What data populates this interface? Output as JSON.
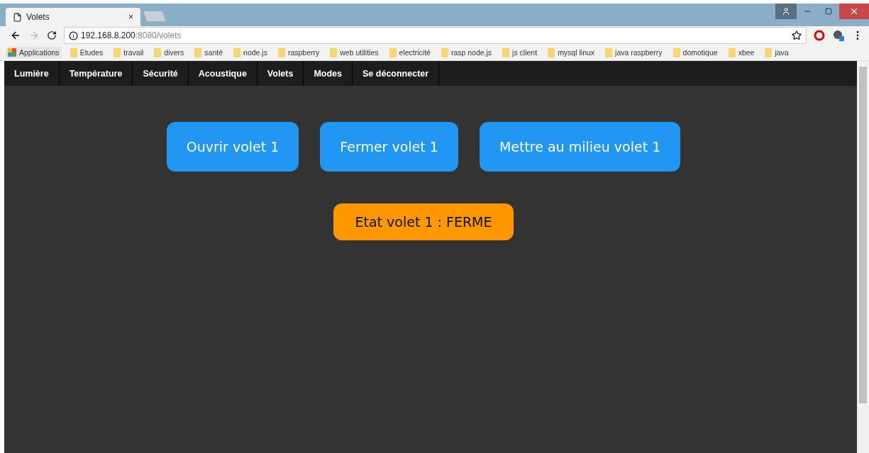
{
  "browser": {
    "tab_title": "Volets",
    "tab_close": "×",
    "url_host": "192.168.8.200",
    "url_path": ":8080/volets",
    "bookmarks": [
      {
        "label": "Applications",
        "kind": "apps"
      },
      {
        "label": "Etudes",
        "kind": "folder"
      },
      {
        "label": "travail",
        "kind": "folder"
      },
      {
        "label": "divers",
        "kind": "folder"
      },
      {
        "label": "santé",
        "kind": "folder"
      },
      {
        "label": "node.js",
        "kind": "folder"
      },
      {
        "label": "raspberry",
        "kind": "folder"
      },
      {
        "label": "web utilities",
        "kind": "folder"
      },
      {
        "label": "electricité",
        "kind": "folder"
      },
      {
        "label": "rasp node.js",
        "kind": "folder"
      },
      {
        "label": "js client",
        "kind": "folder"
      },
      {
        "label": "mysql linux",
        "kind": "folder"
      },
      {
        "label": "java raspberry",
        "kind": "folder"
      },
      {
        "label": "domotique",
        "kind": "folder"
      },
      {
        "label": "xbee",
        "kind": "folder"
      },
      {
        "label": "java",
        "kind": "folder"
      }
    ]
  },
  "nav": [
    {
      "label": "Lumière"
    },
    {
      "label": "Température"
    },
    {
      "label": "Sécurité"
    },
    {
      "label": "Acoustique"
    },
    {
      "label": "Volets"
    },
    {
      "label": "Modes"
    },
    {
      "label": "Se déconnecter"
    }
  ],
  "actions": [
    {
      "label": "Ouvrir volet 1"
    },
    {
      "label": "Fermer volet 1"
    },
    {
      "label": "Mettre au milieu volet 1"
    }
  ],
  "status": {
    "label": "Etat volet 1 : FERME"
  }
}
